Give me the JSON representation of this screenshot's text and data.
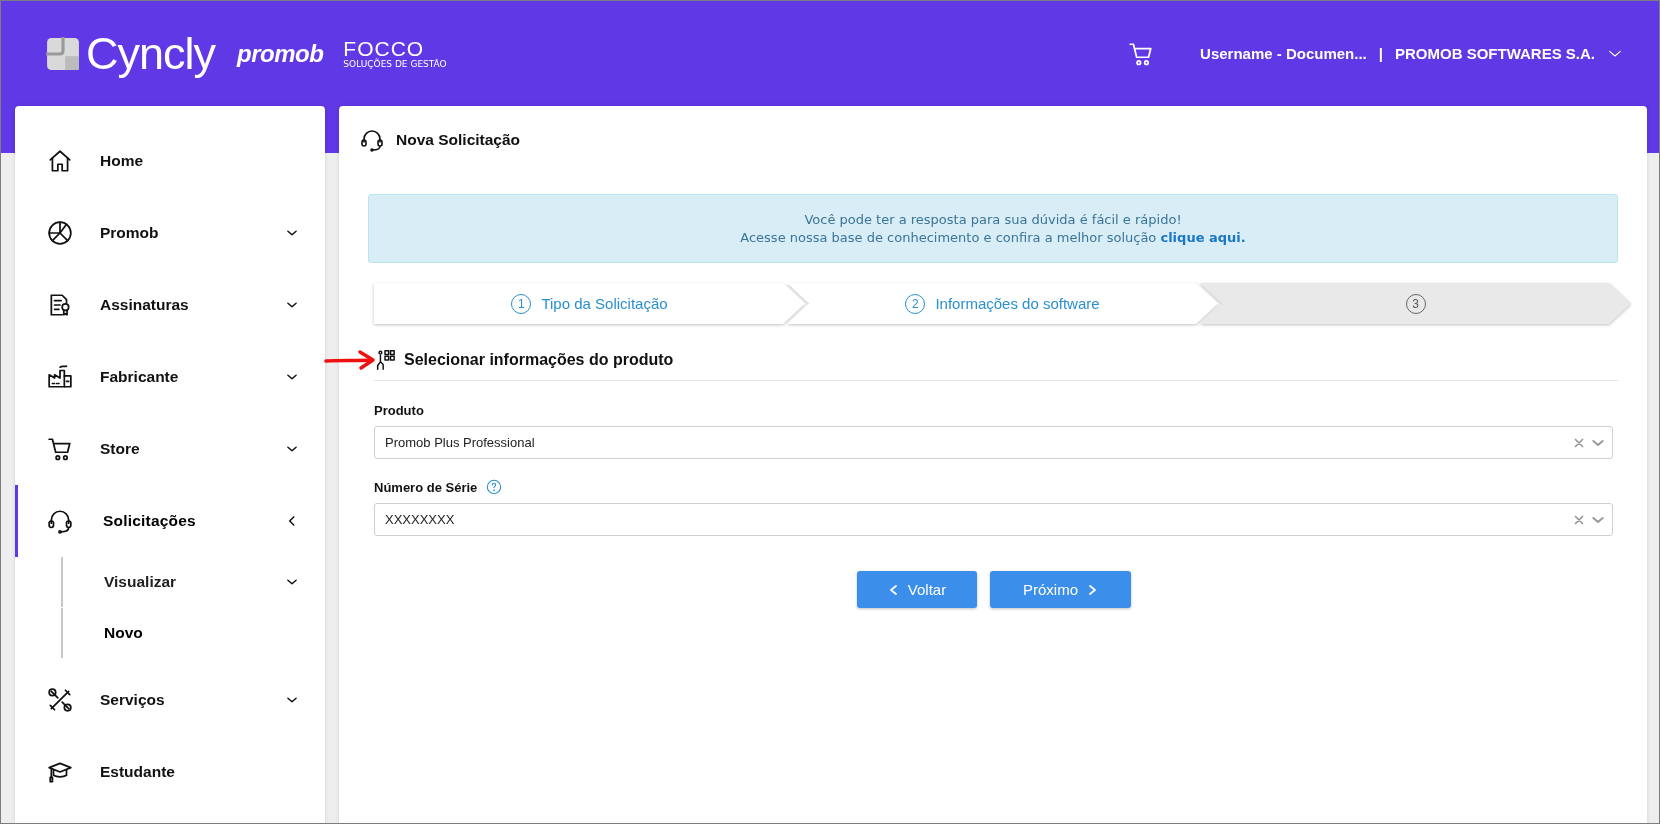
{
  "header": {
    "brands": {
      "cyncly": "Cyncly",
      "promob": "promob",
      "focco": "FOCCO",
      "focco_tagline": "SOLUÇÕES DE GESTÃO"
    },
    "account": {
      "user": "Username - Documen...",
      "separator": "|",
      "company": "PROMOB SOFTWARES S.A."
    }
  },
  "sidebar": {
    "items": [
      {
        "label": "Home",
        "selected": false
      },
      {
        "label": "Promob",
        "selected": false,
        "expanded": false
      },
      {
        "label": "Assinaturas",
        "selected": false,
        "expanded": false
      },
      {
        "label": "Fabricante",
        "selected": false,
        "expanded": false
      },
      {
        "label": "Store",
        "selected": false,
        "expanded": false
      },
      {
        "label": "Solicitações",
        "selected": true,
        "expanded": true,
        "children": [
          {
            "label": "Visualizar",
            "selected": false,
            "expanded": false
          },
          {
            "label": "Novo",
            "selected": true
          }
        ]
      },
      {
        "label": "Serviços",
        "selected": false,
        "expanded": false
      },
      {
        "label": "Estudante",
        "selected": false
      }
    ]
  },
  "page": {
    "title": "Nova Solicitação",
    "info_banner": {
      "line_1": "Você pode ter a resposta para sua dúvida é fácil e rápido!",
      "line_2": "Acesse nossa base de conhecimento e confira a melhor solução",
      "link": "clique aqui."
    },
    "steps": [
      {
        "number": "1",
        "label": "Tipo da Solicitação",
        "active": true
      },
      {
        "number": "2",
        "label": "Informações do software",
        "active": true
      },
      {
        "number": "3",
        "active": false
      }
    ],
    "section_title": "Selecionar informações do produto",
    "fields": [
      {
        "label": "Produto",
        "value": "Promob Plus Professional",
        "help": false
      },
      {
        "label": "Número de Série",
        "value": "XXXXXXXX",
        "help": true
      }
    ],
    "buttons": [
      {
        "label": "Voltar",
        "kind": "back"
      },
      {
        "label": "Próximo",
        "kind": "next"
      }
    ]
  }
}
